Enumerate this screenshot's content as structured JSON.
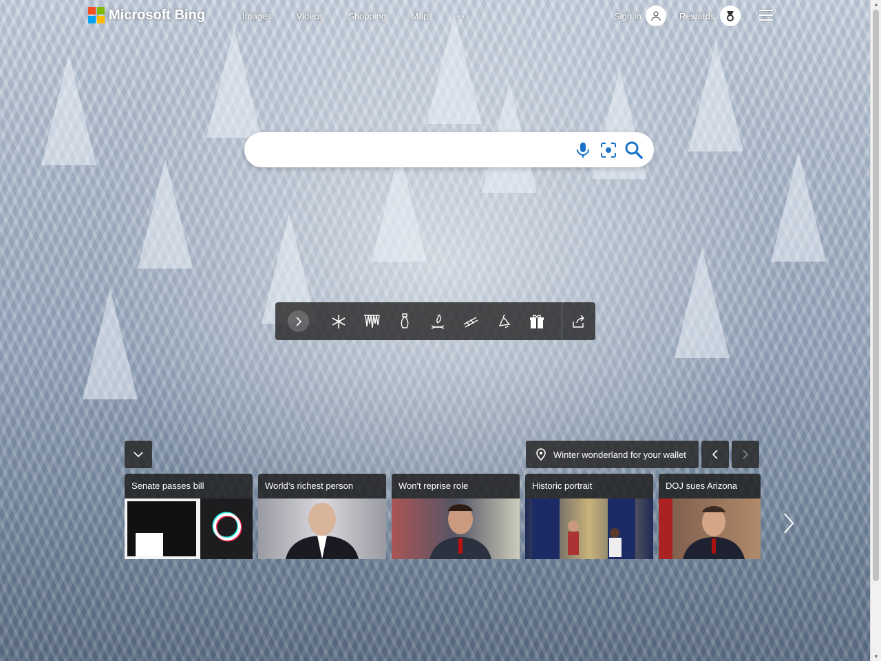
{
  "brand": {
    "name": "Microsoft Bing",
    "colors": [
      "#f25022",
      "#7fba00",
      "#00a4ef",
      "#ffb900"
    ]
  },
  "nav": {
    "items": [
      "Images",
      "Videos",
      "Shopping",
      "Maps"
    ],
    "more": "···"
  },
  "account": {
    "signin_label": "Sign in",
    "rewards_label": "Rewards"
  },
  "search": {
    "value": "",
    "placeholder": ""
  },
  "toolbar": {
    "icons": [
      "snowflake-icon",
      "icicles-icon",
      "ornament-icon",
      "campfire-icon",
      "sled-icon",
      "bell-icon",
      "gift-icon"
    ],
    "share_icon": "share-icon"
  },
  "news": {
    "location_text": "Winter wonderland for your wallet",
    "cards": [
      {
        "title": "Senate passes bill",
        "bg": "#1d1d1f"
      },
      {
        "title": "World’s richest person",
        "bg": "#6d6d73"
      },
      {
        "title": "Won't reprise role",
        "bg": "#8a3a30"
      },
      {
        "title": "Historic portrait",
        "bg": "#3a4a6a"
      },
      {
        "title": "DOJ sues Arizona",
        "bg": "#7a5a4a"
      }
    ]
  }
}
